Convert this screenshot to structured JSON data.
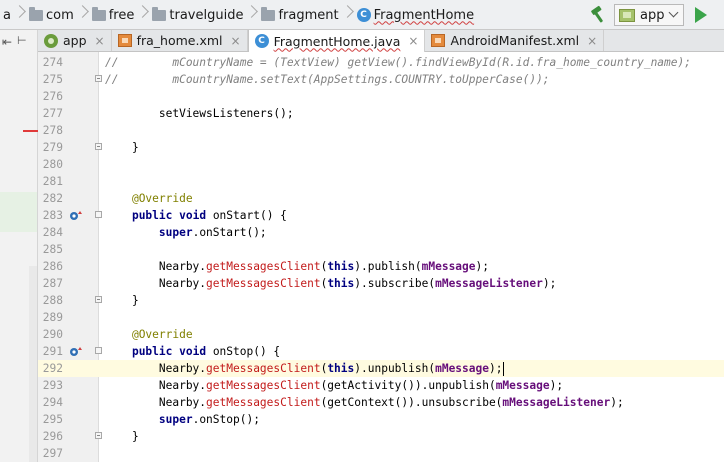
{
  "breadcrumbs": [
    {
      "label": "a",
      "icon": "none"
    },
    {
      "label": "com",
      "icon": "folder-icon"
    },
    {
      "label": "free",
      "icon": "folder-icon"
    },
    {
      "label": "travelguide",
      "icon": "folder-icon"
    },
    {
      "label": "fragment",
      "icon": "folder-icon"
    },
    {
      "label": "FragmentHome",
      "icon": "class-icon"
    }
  ],
  "toolbar": {
    "run_config": "app",
    "build_icon": "hammer-icon",
    "run_icon": "play-icon",
    "run_color": "#3aa44a"
  },
  "tabs": [
    {
      "label": "app",
      "icon": "android-icon",
      "active": false
    },
    {
      "label": "fra_home.xml",
      "icon": "xml-layout-icon",
      "active": false
    },
    {
      "label": "FragmentHome.java",
      "icon": "class-icon",
      "active": true
    },
    {
      "label": "AndroidManifest.xml",
      "icon": "xml-manifest-icon",
      "active": false
    }
  ],
  "tab_close_glyph": "×",
  "editor": {
    "current_line": "292",
    "lines": [
      {
        "num": "274",
        "code": "//        mCountryName = (TextView) getView().findViewById(R.id.fra_home_country_name);",
        "fold": "none"
      },
      {
        "num": "275",
        "code": "//        mCountryName.setText(AppSettings.COUNTRY.toUpperCase());",
        "fold": "end"
      },
      {
        "num": "276",
        "code": "",
        "fold": "none"
      },
      {
        "num": "277",
        "code": "        setViewsListeners();",
        "fold": "none"
      },
      {
        "num": "278",
        "code": "",
        "fold": "none"
      },
      {
        "num": "279",
        "code": "    }",
        "fold": "end"
      },
      {
        "num": "280",
        "code": "",
        "fold": "none"
      },
      {
        "num": "281",
        "code": "",
        "fold": "none"
      },
      {
        "num": "282",
        "code": "    @Override",
        "fold": "none"
      },
      {
        "num": "283",
        "code": "    public void onStart() {",
        "fold": "start",
        "override": true
      },
      {
        "num": "284",
        "code": "        super.onStart();",
        "fold": "none"
      },
      {
        "num": "285",
        "code": "",
        "fold": "none"
      },
      {
        "num": "286",
        "code": "        Nearby.getMessagesClient(this).publish(mMessage);",
        "fold": "none"
      },
      {
        "num": "287",
        "code": "        Nearby.getMessagesClient(this).subscribe(mMessageListener);",
        "fold": "none"
      },
      {
        "num": "288",
        "code": "    }",
        "fold": "end"
      },
      {
        "num": "289",
        "code": "",
        "fold": "none"
      },
      {
        "num": "290",
        "code": "    @Override",
        "fold": "none"
      },
      {
        "num": "291",
        "code": "    public void onStop() {",
        "fold": "start",
        "override": true
      },
      {
        "num": "292",
        "code": "        Nearby.getMessagesClient(this).unpublish(mMessage);",
        "fold": "none"
      },
      {
        "num": "293",
        "code": "        Nearby.getMessagesClient(getActivity()).unpublish(mMessage);",
        "fold": "none"
      },
      {
        "num": "294",
        "code": "        Nearby.getMessagesClient(getContext()).unsubscribe(mMessageListener);",
        "fold": "none"
      },
      {
        "num": "295",
        "code": "        super.onStop();",
        "fold": "none"
      },
      {
        "num": "296",
        "code": "    }",
        "fold": "end"
      },
      {
        "num": "297",
        "code": "",
        "fold": "none"
      }
    ]
  },
  "colors": {
    "keyword": "#000080",
    "annotation": "#808000",
    "comment": "#808080",
    "method_call": "#c21b1b",
    "field": "#660e7a",
    "current_line_bg": "#fffbe0"
  }
}
